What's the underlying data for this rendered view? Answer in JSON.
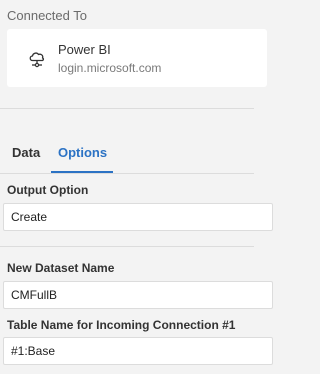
{
  "connection": {
    "section_title": "Connected To",
    "name": "Power BI",
    "host": "login.microsoft.com",
    "icon": "cloud-network-icon"
  },
  "tabs": [
    {
      "label": "Data",
      "active": false
    },
    {
      "label": "Options",
      "active": true
    }
  ],
  "fields": {
    "output_option": {
      "label": "Output Option",
      "value": "Create"
    },
    "dataset_name": {
      "label": "New Dataset Name",
      "value": "CMFullB"
    },
    "table_name": {
      "label": "Table Name for Incoming Connection #1",
      "value": "#1:Base"
    }
  },
  "colors": {
    "accent": "#2b72c4",
    "background": "#f3f3f3",
    "card": "#ffffff"
  }
}
